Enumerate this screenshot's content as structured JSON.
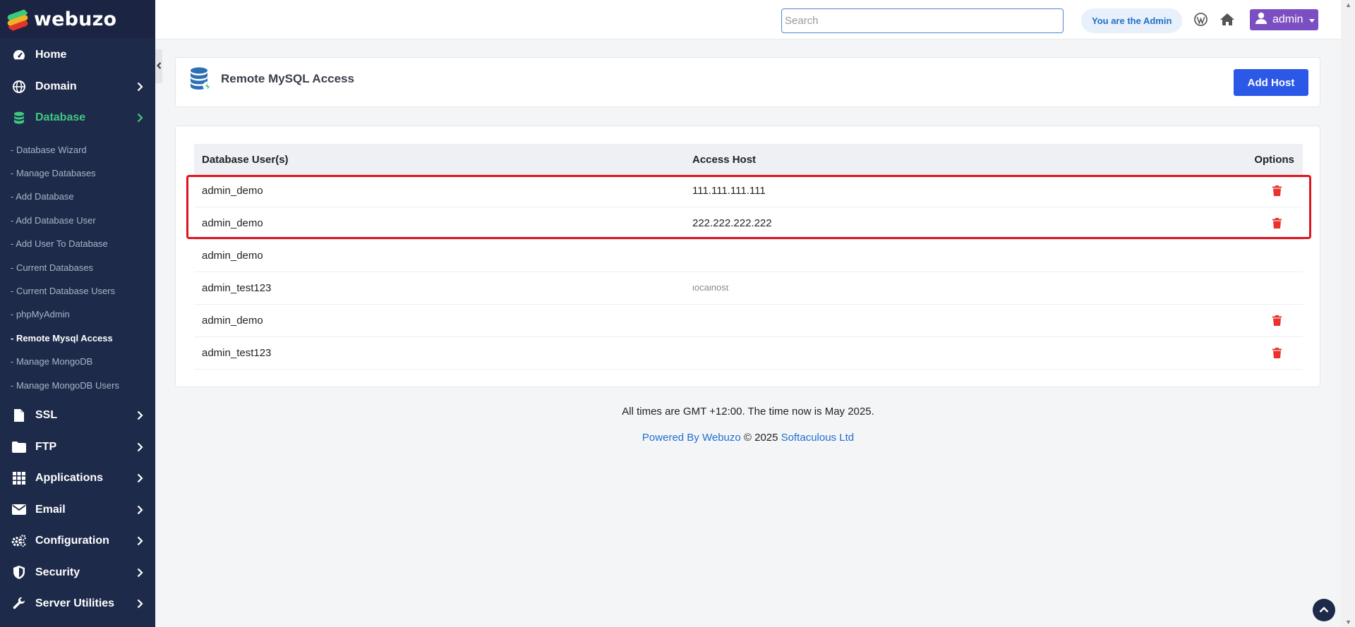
{
  "brand": {
    "name": "webuzo"
  },
  "sidebar": {
    "items": [
      {
        "label": "Home",
        "icon": "dashboard-icon",
        "has_chevron": false
      },
      {
        "label": "Domain",
        "icon": "globe-icon",
        "has_chevron": true
      },
      {
        "label": "Database",
        "icon": "database-icon",
        "has_chevron": true,
        "active": true
      },
      {
        "label": "SSL",
        "icon": "file-icon",
        "has_chevron": true
      },
      {
        "label": "FTP",
        "icon": "folder-icon",
        "has_chevron": true
      },
      {
        "label": "Applications",
        "icon": "grid-icon",
        "has_chevron": true
      },
      {
        "label": "Email",
        "icon": "envelope-icon",
        "has_chevron": true
      },
      {
        "label": "Configuration",
        "icon": "cogs-icon",
        "has_chevron": true
      },
      {
        "label": "Security",
        "icon": "shield-icon",
        "has_chevron": true
      },
      {
        "label": "Server Utilities",
        "icon": "wrench-icon",
        "has_chevron": true
      }
    ],
    "database_sub": [
      "- Database Wizard",
      "- Manage Databases",
      "- Add Database",
      "- Add Database User",
      "- Add User To Database",
      "- Current Databases",
      "- Current Database Users",
      "- phpMyAdmin",
      "- Remote Mysql Access",
      "- Manage MongoDB",
      "- Manage MongoDB Users"
    ],
    "current_sub": "- Remote Mysql Access"
  },
  "topbar": {
    "search_placeholder": "Search",
    "admin_badge": "You are the Admin",
    "user_name": "admin"
  },
  "page": {
    "title": "Remote MySQL Access",
    "add_button": "Add Host"
  },
  "table": {
    "headers": {
      "user": "Database User(s)",
      "host": "Access Host",
      "options": "Options"
    },
    "rows": [
      {
        "user": "admin_demo",
        "host": "111.111.111.111",
        "delete": true
      },
      {
        "user": "admin_demo",
        "host": "222.222.222.222",
        "delete": true
      },
      {
        "user": "admin_demo",
        "host": "",
        "delete": false
      },
      {
        "user": "admin_test123",
        "host": "localhost",
        "delete": false
      },
      {
        "user": "admin_demo",
        "host": "",
        "delete": true
      },
      {
        "user": "admin_test123",
        "host": "",
        "delete": true
      }
    ]
  },
  "footer": {
    "time_text": "All times are GMT +12:00. The time now is May 2025.",
    "powered_by": "Powered By Webuzo",
    "copyright": "© 2025",
    "company": "Softaculous Ltd"
  },
  "colors": {
    "sidebar_bg": "#1e2a4a",
    "active_green": "#3ec97f",
    "primary_blue": "#2b58e6",
    "trash_red": "#e8322c",
    "user_btn": "#7b4fc2",
    "highlight_red": "#e0141e"
  }
}
